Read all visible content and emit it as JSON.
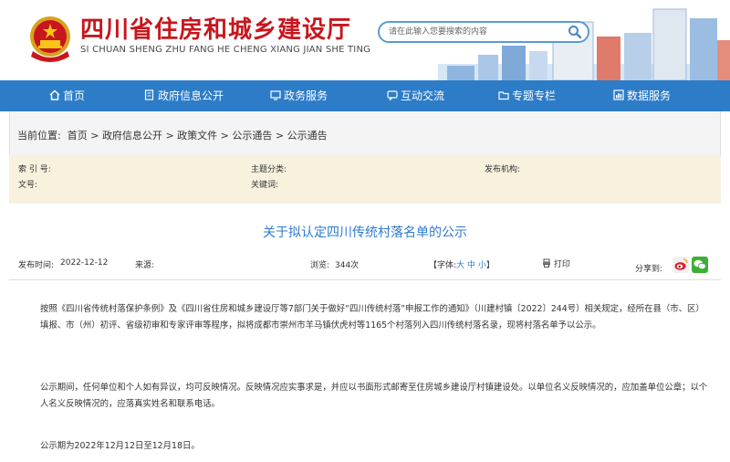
{
  "header": {
    "site_title": "四川省住房和城乡建设厅",
    "site_pinyin": "SI CHUAN SHENG ZHU FANG HE CHENG XIANG JIAN SHE TING",
    "search_placeholder": "请在此输入您要搜索的内容"
  },
  "nav": {
    "items": [
      {
        "label": "首页",
        "icon": "home-icon"
      },
      {
        "label": "政府信息公开",
        "icon": "document-icon"
      },
      {
        "label": "政务服务",
        "icon": "monitor-icon"
      },
      {
        "label": "互动交流",
        "icon": "chat-icon"
      },
      {
        "label": "专题专栏",
        "icon": "folder-icon"
      },
      {
        "label": "数据服务",
        "icon": "chart-icon"
      }
    ]
  },
  "breadcrumb": {
    "label": "当前位置:",
    "items": [
      "首页",
      "政府信息公开",
      "政策文件",
      "公示通告",
      "公示通告"
    ],
    "separator": ">"
  },
  "meta": {
    "index_no": "索 引 号:",
    "doc_no": "文号:",
    "topic": "主题分类:",
    "keywords": "关键词:",
    "publisher": "发布机构:"
  },
  "article": {
    "title": "关于拟认定四川传统村落名单的公示",
    "publish_date_label": "发布时间:",
    "publish_date": "2022-12-12",
    "source_label": "来源:",
    "views_label": "浏览:",
    "views": "344次",
    "font_bracket_open": "【字体:",
    "font_large": "大",
    "font_medium": "中",
    "font_small": "小",
    "font_bracket_close": "】",
    "print_label": "打印",
    "share_label": "分享到:",
    "paragraphs": [
      "按照《四川省传统村落保护条例》及《四川省住房和城乡建设厅等7部门关于做好“四川传统村落”申报工作的通知》（川建村镇〔2022〕244号）相关规定，经所在县（市、区）填报、市（州）初评、省级初审和专家评审等程序，拟将成都市崇州市羊马镇伏虎村等1165个村落列入四川传统村落名录，现将村落名单予以公示。",
      "公示期间，任何单位和个人如有异议，均可反映情况。反映情况应实事求是，并应以书面形式邮寄至住房城乡建设厅村镇建设处。以单位名义反映情况的，应加盖单位公章；以个人名义反映情况的，应落真实姓名和联系电话。",
      "公示期为2022年12月12日至12月18日。"
    ]
  },
  "colors": {
    "nav_bg": "#2d7cc8",
    "title_red": "#c8161d",
    "title_blue": "#2e7bd0",
    "meta_bg": "#f7f1de"
  }
}
